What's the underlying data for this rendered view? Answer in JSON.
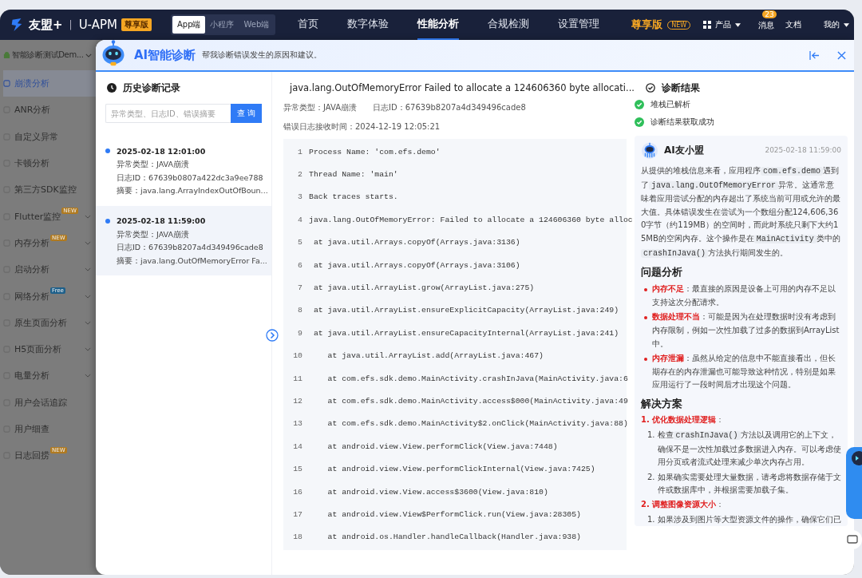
{
  "top_nav": {
    "brand": "友盟+",
    "separator": "|",
    "product": "U-APM",
    "edition_badge": "尊享版",
    "platforms": [
      {
        "label": "App端",
        "selected": true
      },
      {
        "label": "小程序",
        "selected": false
      },
      {
        "label": "Web端",
        "selected": false
      }
    ],
    "menu": [
      {
        "label": "首页",
        "selected": false
      },
      {
        "label": "数字体验",
        "selected": false
      },
      {
        "label": "性能分析",
        "selected": true
      },
      {
        "label": "合规检测",
        "selected": false
      },
      {
        "label": "设置管理",
        "selected": false
      }
    ],
    "premium": "尊享版",
    "premium_badge": "NEW",
    "products": "产品",
    "messages": "消息",
    "message_count": "23",
    "docs": "文档",
    "account": "我的"
  },
  "sidebar": {
    "app": "智能诊断测试Dem...",
    "items": [
      {
        "label": "崩溃分析",
        "selected": true,
        "expandable": false
      },
      {
        "label": "ANR分析",
        "selected": false,
        "expandable": false
      },
      {
        "label": "自定义异常",
        "selected": false,
        "expandable": false
      },
      {
        "label": "卡顿分析",
        "selected": false,
        "expandable": false
      },
      {
        "label": "第三方SDK监控",
        "selected": false,
        "expandable": false
      },
      {
        "label": "Flutter监控",
        "badge": "NEW",
        "color": "#b07a20",
        "selected": false,
        "expandable": true
      },
      {
        "label": "内存分析",
        "badge": "NEW",
        "color": "#b07a20",
        "selected": false,
        "expandable": true
      },
      {
        "label": "启动分析",
        "selected": false,
        "expandable": true
      },
      {
        "label": "网络分析",
        "badge": "Free",
        "color": "#1d5f8a",
        "selected": false,
        "expandable": true
      },
      {
        "label": "原生页面分析",
        "selected": false,
        "expandable": true
      },
      {
        "label": "H5页面分析",
        "selected": false,
        "expandable": true
      },
      {
        "label": "电量分析",
        "selected": false,
        "expandable": true
      },
      {
        "label": "用户会话追踪",
        "selected": false,
        "expandable": false
      },
      {
        "label": "用户细查",
        "selected": false,
        "expandable": false
      },
      {
        "label": "日志回捞",
        "badge": "NEW",
        "color": "#b07a20",
        "selected": false,
        "expandable": false
      }
    ]
  },
  "dialog": {
    "title": "AI智能诊断",
    "subtitle": "帮我诊断错误发生的原因和建议。"
  },
  "history": {
    "title": "历史诊断记录",
    "search": {
      "placeholder": "异常类型、日志ID、错误摘要"
    },
    "search_button": "查 询",
    "records": [
      {
        "time": "2025-02-18 12:01:00",
        "lines": [
          "异常类型：JAVA崩溃",
          "日志ID：67639b0807a422dc3a9ee788",
          "摘要：java.lang.ArrayIndexOutOfBoun..."
        ],
        "selected": false
      },
      {
        "time": "2025-02-18 11:59:00",
        "lines": [
          "异常类型：JAVA崩溃",
          "日志ID：67639b8207a4d349496cade8",
          "摘要：java.lang.OutOfMemoryError Fa..."
        ],
        "selected": true
      }
    ]
  },
  "error": {
    "title": "java.lang.OutOfMemoryError Failed to allocate a 124606360 byte allocati...",
    "type": "异常类型：JAVA崩溃",
    "log_id": "日志ID：67639b8207a4d349496cade8",
    "received": "错误日志接收时间：2024-12-19 12:05:21",
    "code": [
      {
        "n": "1",
        "text": "Process Name: 'com.efs.demo'"
      },
      {
        "n": "2",
        "text": "Thread Name: 'main'"
      },
      {
        "n": "3",
        "text": "Back traces starts."
      },
      {
        "n": "4",
        "text": "java.lang.OutOfMemoryError: Failed to allocate a 124606360 byte alloc"
      },
      {
        "n": "5",
        "text": " at java.util.Arrays.copyOf(Arrays.java:3136)"
      },
      {
        "n": "6",
        "text": " at java.util.Arrays.copyOf(Arrays.java:3106)"
      },
      {
        "n": "7",
        "text": " at java.util.ArrayList.grow(ArrayList.java:275)"
      },
      {
        "n": "8",
        "text": " at java.util.ArrayList.ensureExplicitCapacity(ArrayList.java:249)"
      },
      {
        "n": "9",
        "text": " at java.util.ArrayList.ensureCapacityInternal(ArrayList.java:241)"
      },
      {
        "n": "10",
        "text": "    at java.util.ArrayList.add(ArrayList.java:467)"
      },
      {
        "n": "11",
        "text": "    at com.efs.sdk.demo.MainActivity.crashInJava(MainActivity.java:6"
      },
      {
        "n": "12",
        "text": "    at com.efs.sdk.demo.MainActivity.access$000(MainActivity.java:49"
      },
      {
        "n": "13",
        "text": "    at com.efs.sdk.demo.MainActivity$2.onClick(MainActivity.java:88)"
      },
      {
        "n": "14",
        "text": "    at android.view.View.performClick(View.java:7448)"
      },
      {
        "n": "15",
        "text": "    at android.view.View.performClickInternal(View.java:7425)"
      },
      {
        "n": "16",
        "text": "    at android.view.View.access$3600(View.java:810)"
      },
      {
        "n": "17",
        "text": "    at android.view.View$PerformClick.run(View.java:28305)"
      },
      {
        "n": "18",
        "text": "    at android.os.Handler.handleCallback(Handler.java:938)"
      }
    ]
  },
  "result": {
    "title": "诊断结果",
    "steps": [
      {
        "label": "堆栈已解析",
        "done": true
      },
      {
        "label": "诊断结果获取成功",
        "done": true
      }
    ],
    "assistant": "AI友小盟",
    "time": "2025-02-18 11:59:00",
    "summary": [
      {
        "kind": "text",
        "text": "从提供的堆栈信息来看，应用程序"
      },
      {
        "kind": "code",
        "text": "com.efs.demo"
      },
      {
        "kind": "text",
        "text": "遇到了"
      },
      {
        "kind": "code",
        "text": "java.lang.OutOfMemoryError"
      },
      {
        "kind": "text",
        "text": "异常。这通常意味着应用尝试分配的内存超出了系统当前可用或允许的最大值。具体错误发生在尝试为一个数组分配124,606,360字节（约119MB）的空间时，而此时系统只剩下大约15MB的空闲内存。这个操作是在"
      },
      {
        "kind": "code",
        "text": "MainActivity"
      },
      {
        "kind": "text",
        "text": "类中的"
      },
      {
        "kind": "code",
        "text": "crashInJava()"
      },
      {
        "kind": "text",
        "text": "方法执行期间发生的。"
      }
    ],
    "analysis_title": "问题分析",
    "analysis": [
      "**内存不足**：最直接的原因是设备上可用的内存不足以支持这次分配请求。",
      "**数据处理不当**：可能是因为在处理数据时没有考虑到内存限制，例如一次性加载了过多的数据到ArrayList中。",
      "**内存泄漏**：虽然从给定的信息中不能直接看出，但长期存在的内存泄漏也可能导致这种情况，特别是如果应用运行了一段时间后才出现这个问题。"
    ],
    "solution_title": "解决方案",
    "solutions": [
      {
        "title": "**1. 优化数据处理逻辑**：",
        "steps": [
          {
            "n": "1.",
            "parts": [
              {
                "kind": "text",
                "text": "检查"
              },
              {
                "kind": "code",
                "text": "crashInJava()"
              },
              {
                "kind": "text",
                "text": "方法以及调用它的上下文，确保不是一次性加载过多数据进入内存。可以考虑使用分页或者流式处理来减少单次内存占用。"
              }
            ]
          },
          {
            "n": "2.",
            "parts": [
              {
                "kind": "text",
                "text": "如果确实需要处理大量数据，请考虑将数据存储于文件或数据库中，并根据需要加载子集。"
              }
            ]
          }
        ]
      },
      {
        "title": "**2. 调整图像资源大小**：",
        "steps": [
          {
            "n": "1.",
            "parts": [
              {
                "kind": "text",
                "text": "如果涉及到图片等大型资源文件的操作，确保它们已"
              }
            ]
          }
        ]
      }
    ]
  }
}
